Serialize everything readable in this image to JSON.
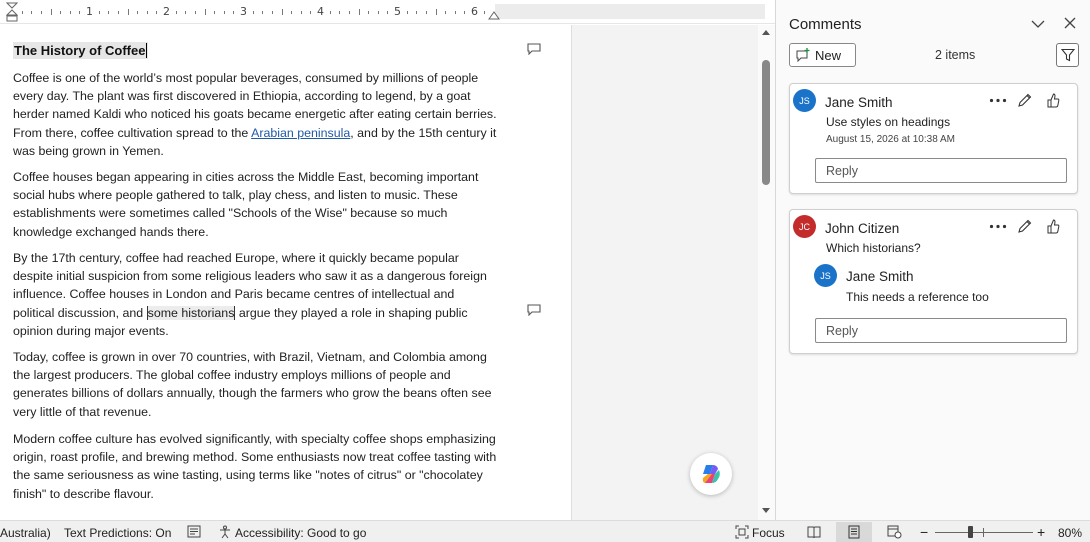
{
  "ruler": {
    "numbers": [
      "1",
      "2",
      "3",
      "4",
      "5",
      "6"
    ]
  },
  "document": {
    "title": "The History of Coffee",
    "p1": {
      "before_link": "Coffee is one of the world’s most popular beverages, consumed by millions of people every day. The plant was first discovered in Ethiopia, according to legend, by a goat herder named Kaldi who noticed his goats became energetic after eating certain berries. From there, coffee cultivation spread to the ",
      "link": "Arabian peninsula",
      "after_link": ", and by the 15th century it was being grown in Yemen."
    },
    "p2": "Coffee houses began appearing in cities across the Middle East, becoming important social hubs where people gathered to talk, play chess, and listen to music. These establishments were sometimes called \"Schools of the Wise\" because so much knowledge exchanged hands there.",
    "p3": {
      "before": "By the 17th century, coffee had reached Europe, where it quickly became popular despite initial suspicion from some religious leaders who saw it as a dangerous foreign influence. Coffee houses in London and Paris became centres of intellectual and political discussion, and ",
      "highlight": "some historians",
      "after": " argue they played a role in shaping public opinion during major events."
    },
    "p4": "Today, coffee is grown in over 70 countries, with Brazil, Vietnam, and Colombia among the largest producers. The global coffee industry employs millions of people and generates billions of dollars annually, though the farmers who grow the beans often see very little of that revenue.",
    "p5": "Modern coffee culture has evolved significantly, with specialty coffee shops emphasizing origin, roast profile, and brewing method. Some enthusiasts now treat coffee tasting with the same seriousness as wine tasting, using terms like \"notes of citrus\" or \"chocolatey finish\" to describe flavour."
  },
  "comments_pane": {
    "title": "Comments",
    "new_label": "New",
    "items_count": "2 items",
    "comments": [
      {
        "initials": "JS",
        "author": "Jane Smith",
        "text": "Use styles on headings",
        "date": "August 15, 2026 at 10:38 AM",
        "reply_placeholder": "Reply"
      },
      {
        "initials": "JC",
        "author": "John Citizen",
        "text": "Which historians?",
        "reply": {
          "initials": "JS",
          "author": "Jane Smith",
          "text": "This needs a reference too"
        },
        "reply_placeholder": "Reply"
      }
    ]
  },
  "status_bar": {
    "language": "Australia)",
    "text_predictions": "Text Predictions: On",
    "accessibility": "Accessibility: Good to go",
    "focus": "Focus",
    "zoom": "80%"
  },
  "colors": {
    "avatar_blue": "#1a73c8",
    "avatar_red": "#c42b2b",
    "link": "#1f5aa6"
  }
}
